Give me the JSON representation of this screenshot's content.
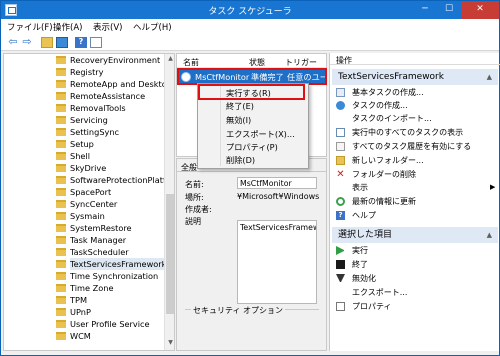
{
  "window": {
    "title": "タスク スケジューラ",
    "min": "─",
    "max": "☐",
    "close": "✕"
  },
  "menu": [
    "ファイル(F)",
    "操作(A)",
    "表示(V)",
    "ヘルプ(H)"
  ],
  "tree": {
    "items": [
      "RecoveryEnvironment",
      "Registry",
      "RemoteApp and Desktop",
      "RemoteAssistance",
      "RemovalTools",
      "Servicing",
      "SettingSync",
      "Setup",
      "Shell",
      "SkyDrive",
      "SoftwareProtectionPlatfo",
      "SpacePort",
      "SyncCenter",
      "Sysmain",
      "SystemRestore",
      "Task Manager",
      "TaskScheduler",
      "TextServicesFramework",
      "Time Synchronization",
      "Time Zone",
      "TPM",
      "UPnP",
      "User Profile Service",
      "WCM"
    ],
    "selected_index": 17
  },
  "tasks": {
    "columns": [
      "名前",
      "状態",
      "トリガー"
    ],
    "row": {
      "name": "MsCtfMonitor",
      "status": "準備完了",
      "trigger": "任意のユーザ"
    }
  },
  "context_menu": [
    "実行する(R)",
    "終了(E)",
    "無効(I)",
    "エクスポート(X)...",
    "プロパティ(P)",
    "削除(D)"
  ],
  "detail": {
    "tab": "全般",
    "name_label": "名前:",
    "name_value": "MsCtfMonitor",
    "location_label": "場所:",
    "location_value": "¥Microsoft¥Windows¥T",
    "author_label": "作成者:",
    "desc_label": "説明",
    "desc_value": "TextServicesFramewo",
    "security_label": "セキュリティ オプション"
  },
  "actions": {
    "header": "操作",
    "group1": "TextServicesFramework",
    "group1_items": [
      "基本タスクの作成...",
      "タスクの作成...",
      "タスクのインポート...",
      "実行中のすべてのタスクの表示",
      "すべてのタスク履歴を有効にする",
      "新しいフォルダー...",
      "フォルダーの削除",
      "表示",
      "最新の情報に更新",
      "ヘルプ"
    ],
    "group2": "選択した項目",
    "group2_items": [
      "実行",
      "終了",
      "無効化",
      "エクスポート...",
      "プロパティ"
    ]
  }
}
